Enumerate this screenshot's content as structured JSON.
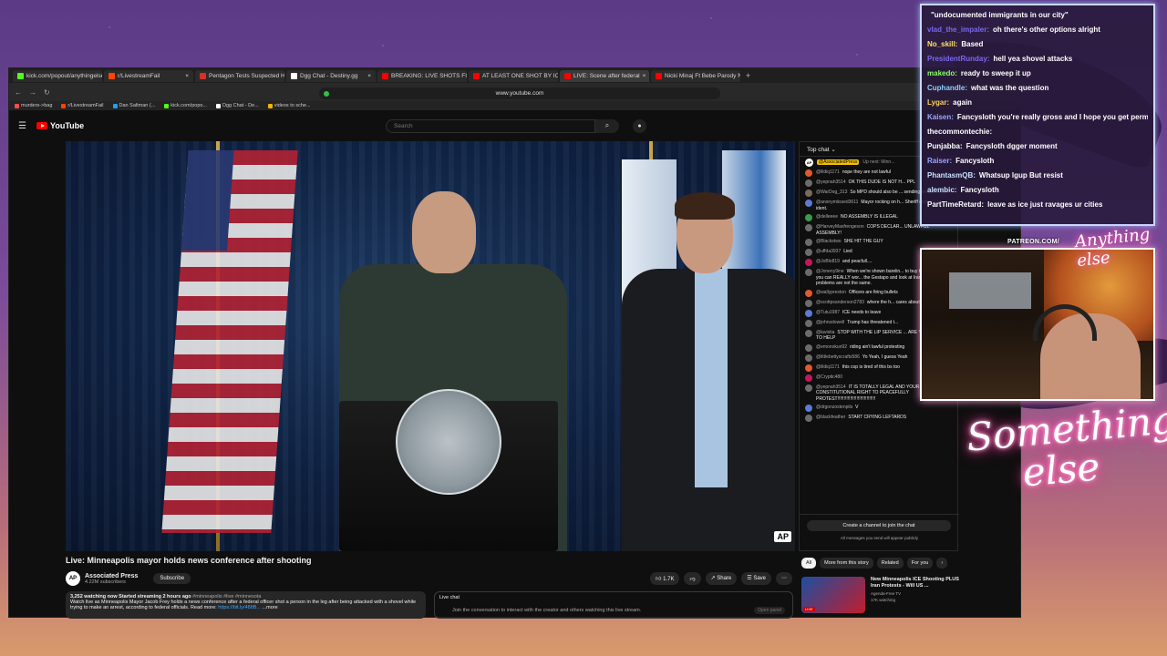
{
  "browser": {
    "tabs": [
      {
        "label": "kick.com/popout/anythingelse/chat",
        "color": "#53fc18"
      },
      {
        "label": "r/LivestreamFail",
        "color": "#ff4500"
      },
      {
        "label": "Pentagon Tests Suspected Havana",
        "color": "#d93025"
      },
      {
        "label": "Dgg Chat - Destiny.gg",
        "color": "#ffffff"
      },
      {
        "label": "BREAKING: LIVE SHOTS FIRED An",
        "color": "#ff0000"
      },
      {
        "label": "AT LEAST ONE SHOT BY ICE IN M",
        "color": "#ff0000"
      },
      {
        "label": "LIVE: Scene after federal",
        "color": "#ff0000"
      },
      {
        "label": "Nicki Minaj Ft Bebe Parody Nasm",
        "color": "#ff0000"
      }
    ],
    "url": "www.youtube.com",
    "bookmarks": [
      {
        "label": "murders->bag",
        "color": "#ff4b4b"
      },
      {
        "label": "r/LivestreamFail",
        "color": "#ff4500"
      },
      {
        "label": "Dan Saltman (...",
        "color": "#1da1f2"
      },
      {
        "label": "kick.com/popo...",
        "color": "#53fc18"
      },
      {
        "label": "Dgg Chat - De...",
        "color": "#ffffff"
      },
      {
        "label": "videos to sche...",
        "color": "#f4b400"
      }
    ]
  },
  "youtube": {
    "logo": "YouTube",
    "search_placeholder": "Search",
    "video": {
      "title": "Live: Minneapolis mayor holds news conference after shooting",
      "channel": "Associated Press",
      "channel_avatar": "AP",
      "subscribers": "4.22M subscribers",
      "subscribe_label": "Subscribe",
      "likes": "1.7K",
      "share_label": "Share",
      "save_label": "Save",
      "watermark": "AP"
    },
    "description": {
      "meta": "3,252 watching now  Started streaming 2 hours ago",
      "tags": " #minneapolis #live #minnesota",
      "text": "Watch live as Minneapolis Mayor Jacob Frey holds a news conference after a federal officer shot a person in the leg after being attacked with a shovel while trying to make an arrest, according to federal officials. Read more: ",
      "link": "https://bit.ly/488B...",
      "more": " ...more"
    },
    "live_chat_box": {
      "title": "Live chat",
      "text": "Join the conversation to interact with the creator and others watching this live stream.",
      "button": "Open panel"
    },
    "chat": {
      "header": "Top chat",
      "pinned_name": "@AssociatedPress",
      "pinned_upnext": "Up next: Minn...",
      "create_button": "Create a channel to join the chat",
      "footnote": "All messages you send will appear publicly",
      "messages": [
        {
          "user": "@lildiq1171",
          "text": "nope they are not lawful",
          "color": "#e05a2b"
        },
        {
          "user": "@yepnah3514",
          "text": "OK THIS DUDE IS NOT H... PPL",
          "color": "#6b6b6b"
        },
        {
          "user": "@WarDog_313",
          "text": "So MPD should also be ... sending people to jail.",
          "color": "#7b6b5b"
        },
        {
          "user": "@anonymiissed3611",
          "text": "Mayor rocking on h... Sheriff explains in ident.",
          "color": "#5b7bd5"
        },
        {
          "user": "@delleeee",
          "text": "NO ASSEMBLY IS ILLEGAL",
          "color": "#3c9a4b"
        },
        {
          "user": "@HarveyMaxfrengeson",
          "text": "COPS DECLAR... UNLAWFUL ASSEMBLY!",
          "color": "#6b6b6b"
        },
        {
          "user": "@Blackstwo",
          "text": "SHE HIT THE GUY",
          "color": "#6b6b6b"
        },
        {
          "user": "@uffda3937",
          "text": "Lied",
          "color": "#6b6b6b"
        },
        {
          "user": "@JoBlo819",
          "text": "and peacfull....",
          "color": "#c2185b"
        },
        {
          "user": "@Joneny9ine",
          "text": "When we're shown barelin... to buy bread....then you can REALLY wor... the Gestapo and look at Iran's situation. ... problems are not the same.",
          "color": "#6b6b6b"
        },
        {
          "user": "@wallypreston",
          "text": "Officers are firing bullets",
          "color": "#e05a2b"
        },
        {
          "user": "@scottpsanderson2783",
          "text": "where the h... cares about paw",
          "color": "#6b6b6b"
        },
        {
          "user": "@Tutu1987",
          "text": "ICE needs to leave",
          "color": "#5b7bd5"
        },
        {
          "user": "@johnsdowell",
          "text": "Trump has threatened t...",
          "color": "#6b6b6b"
        },
        {
          "user": "@lavistia",
          "text": "STOP WITH THE LIP SERVICE ... ARE YOU DOING TO HELP",
          "color": "#6b6b6b"
        },
        {
          "user": "@emonokun92",
          "text": "riding ain't lawful protesting",
          "color": "#6b6b6b"
        },
        {
          "user": "@littlebettyscrafts586",
          "text": "Yo Yeah, I guess Yeah",
          "color": "#6b6b6b"
        },
        {
          "user": "@lildiq1171",
          "text": "this cop is tired of this bs too",
          "color": "#e05a2b"
        },
        {
          "user": "@Cryptic480",
          "text": "",
          "color": "#c2185b"
        },
        {
          "user": "@yepnah3514",
          "text": "IT IS TOTALLY LEGAL AND YOUR CONSTITUTIONAL RIGHT TO PEACEFULLY PROTEST!!!!!!!!!!!!!!!!!!!!!!!!!!!!!!",
          "color": "#6b6b6b"
        },
        {
          "user": "@drgonzostenpils",
          "text": "V",
          "color": "#5b7bd5"
        },
        {
          "user": "@blackfeather",
          "text": "START CRYING LEFTARDS",
          "color": "#6b6b6b"
        }
      ]
    },
    "chips": [
      "All",
      "More from this story",
      "Related",
      "For you"
    ],
    "recommendation": {
      "title": "New Minneapolis ICE Shooting PLUS Iran Protests - Will US ...",
      "channel": "Agenda-Free TV",
      "watching": "17K watching",
      "badge": "LIVE"
    }
  },
  "stream_chat": [
    {
      "user": "",
      "text": "\"undocumented immigrants in our city\"",
      "color": "#ffffff"
    },
    {
      "user": "vlad_the_impaler:",
      "text": "oh there's other options alright",
      "color": "#7b68ee"
    },
    {
      "user": "No_skill:",
      "text": "Based",
      "color": "#ffe066"
    },
    {
      "user": "PresidentRunday:",
      "text": "hell yea shovel attacks",
      "color": "#7b68ee"
    },
    {
      "user": "makedo:",
      "text": "ready to sweep it up",
      "color": "#8cff66"
    },
    {
      "user": "Cuphandle:",
      "text": "what was the question",
      "color": "#8ad0ff"
    },
    {
      "user": "Lygar:",
      "text": "again",
      "color": "#ffd24d"
    },
    {
      "user": "Kaisen:",
      "text": "Fancysloth you're really gross and I hope you get permabanned eventually.",
      "color": "#9aa7ff"
    },
    {
      "user": "thecommontechie:",
      "text": "",
      "color": "#ffffff"
    },
    {
      "user": "Punjabba:",
      "text": "Fancysloth  dgger moment",
      "color": "#ffffff"
    },
    {
      "user": "Raiser:",
      "text": "Fancysloth",
      "color": "#9aa7ff"
    },
    {
      "user": "PhantasmQB:",
      "text": "Whatsup lgup  But resist",
      "color": "#c9e0ff"
    },
    {
      "user": "alembic:",
      "text": "Fancysloth",
      "color": "#c9e0ff"
    },
    {
      "user": "PartTimeRetard:",
      "text": "leave as ice just ravages ur cities",
      "color": "#ffffff"
    }
  ],
  "overlay": {
    "patreon": "PATREON.COM/",
    "brand": "Anything else",
    "neon": "Something else"
  }
}
